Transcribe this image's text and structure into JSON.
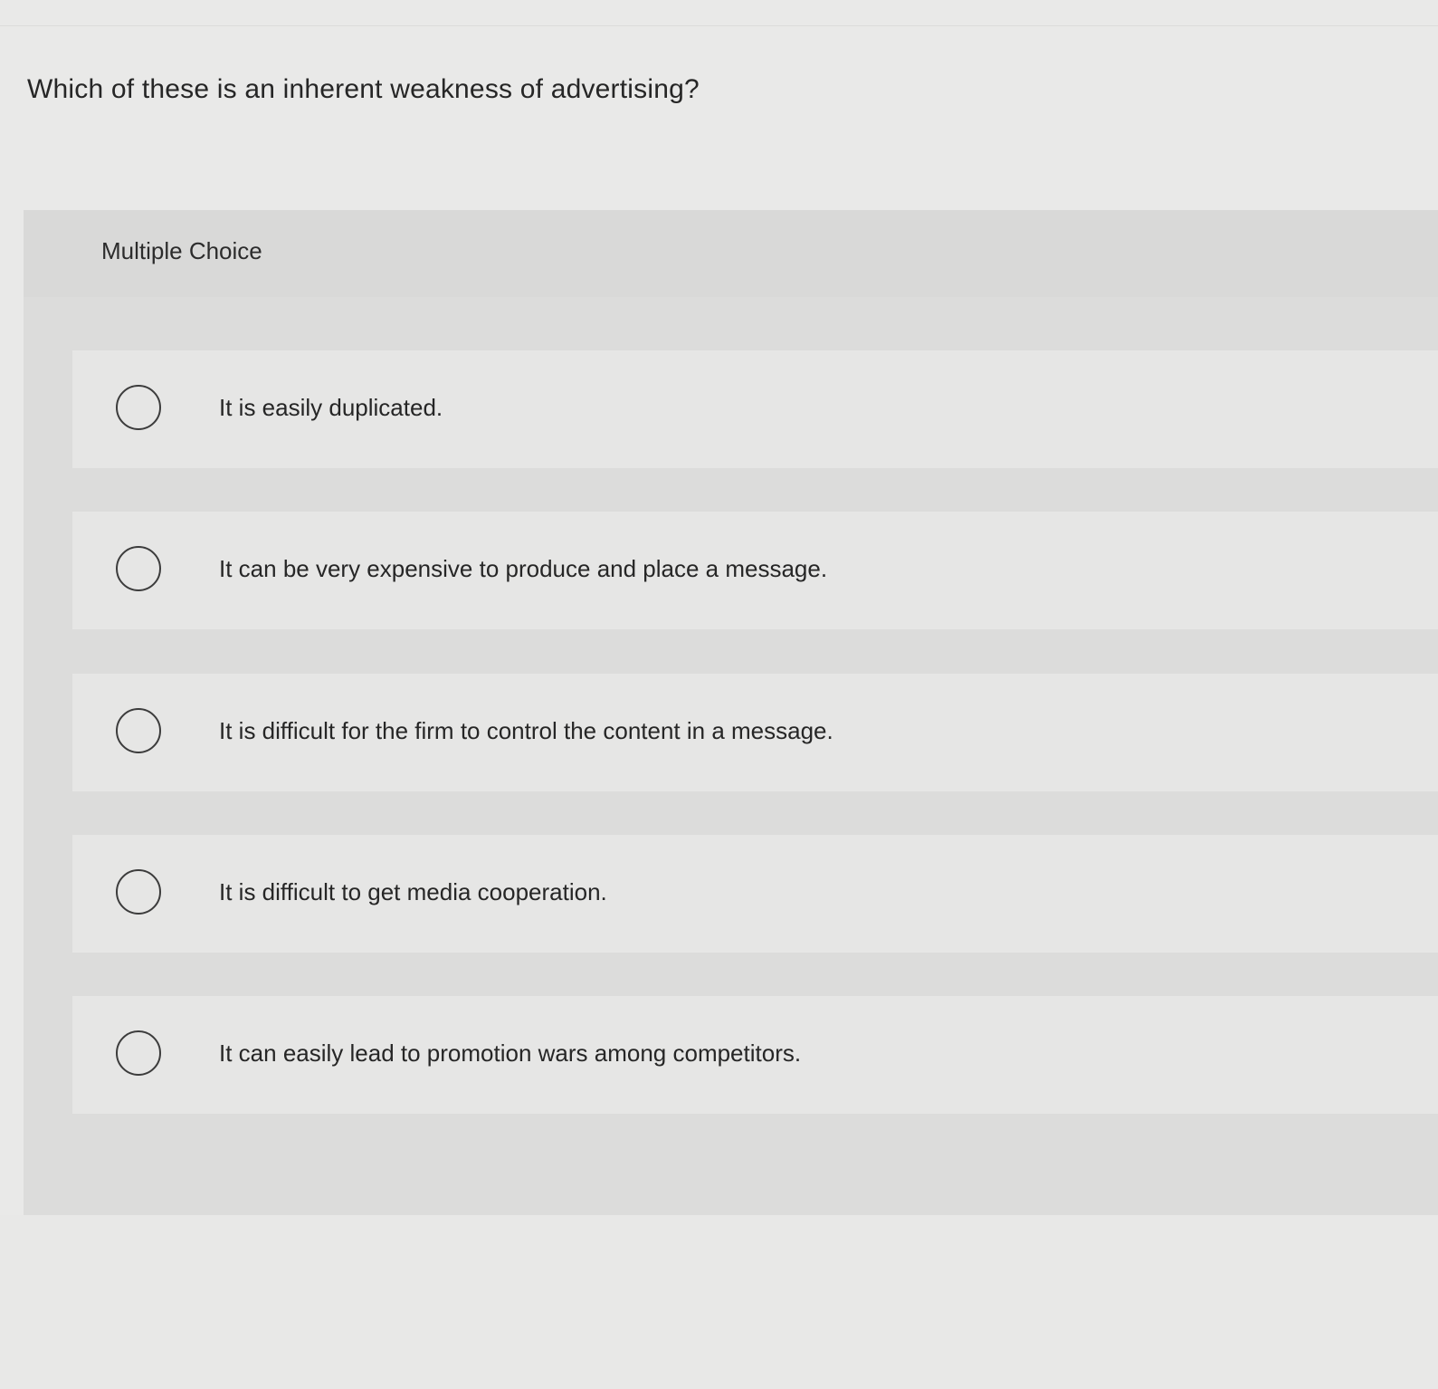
{
  "question": {
    "text": "Which of these is an inherent weakness of advertising?"
  },
  "panel": {
    "label": "Multiple Choice"
  },
  "options": [
    {
      "label": "It is easily duplicated.",
      "selected": false
    },
    {
      "label": "It can be very expensive to produce and place a message.",
      "selected": false
    },
    {
      "label": "It is difficult for the firm to control the content in a message.",
      "selected": false
    },
    {
      "label": "It is difficult to get media cooperation.",
      "selected": false
    },
    {
      "label": "It can easily lead to promotion wars among competitors.",
      "selected": false
    }
  ],
  "colors": {
    "background": "#e9e9e8",
    "panel": "#dcdcdb",
    "option_row": "#e6e6e5",
    "text": "#262626",
    "radio_border": "#3c3c3c"
  }
}
